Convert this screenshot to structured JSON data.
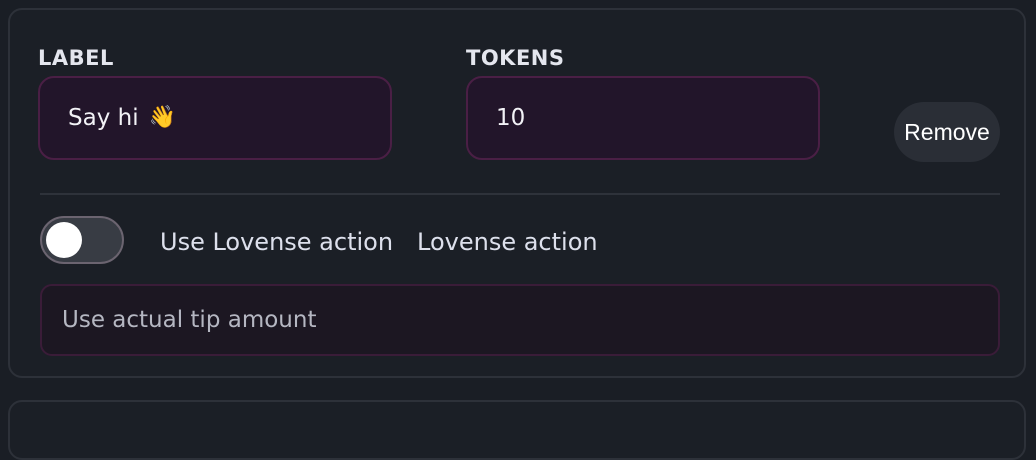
{
  "item": {
    "label_heading": "LABEL",
    "label_value": "Say hi",
    "label_emoji": "👋",
    "tokens_heading": "TOKENS",
    "tokens_value": "10",
    "remove_label": "Remove",
    "toggle_on": false,
    "toggle_label": "Use Lovense action",
    "action_label": "Lovense action",
    "tip_placeholder": "Use actual tip amount"
  }
}
